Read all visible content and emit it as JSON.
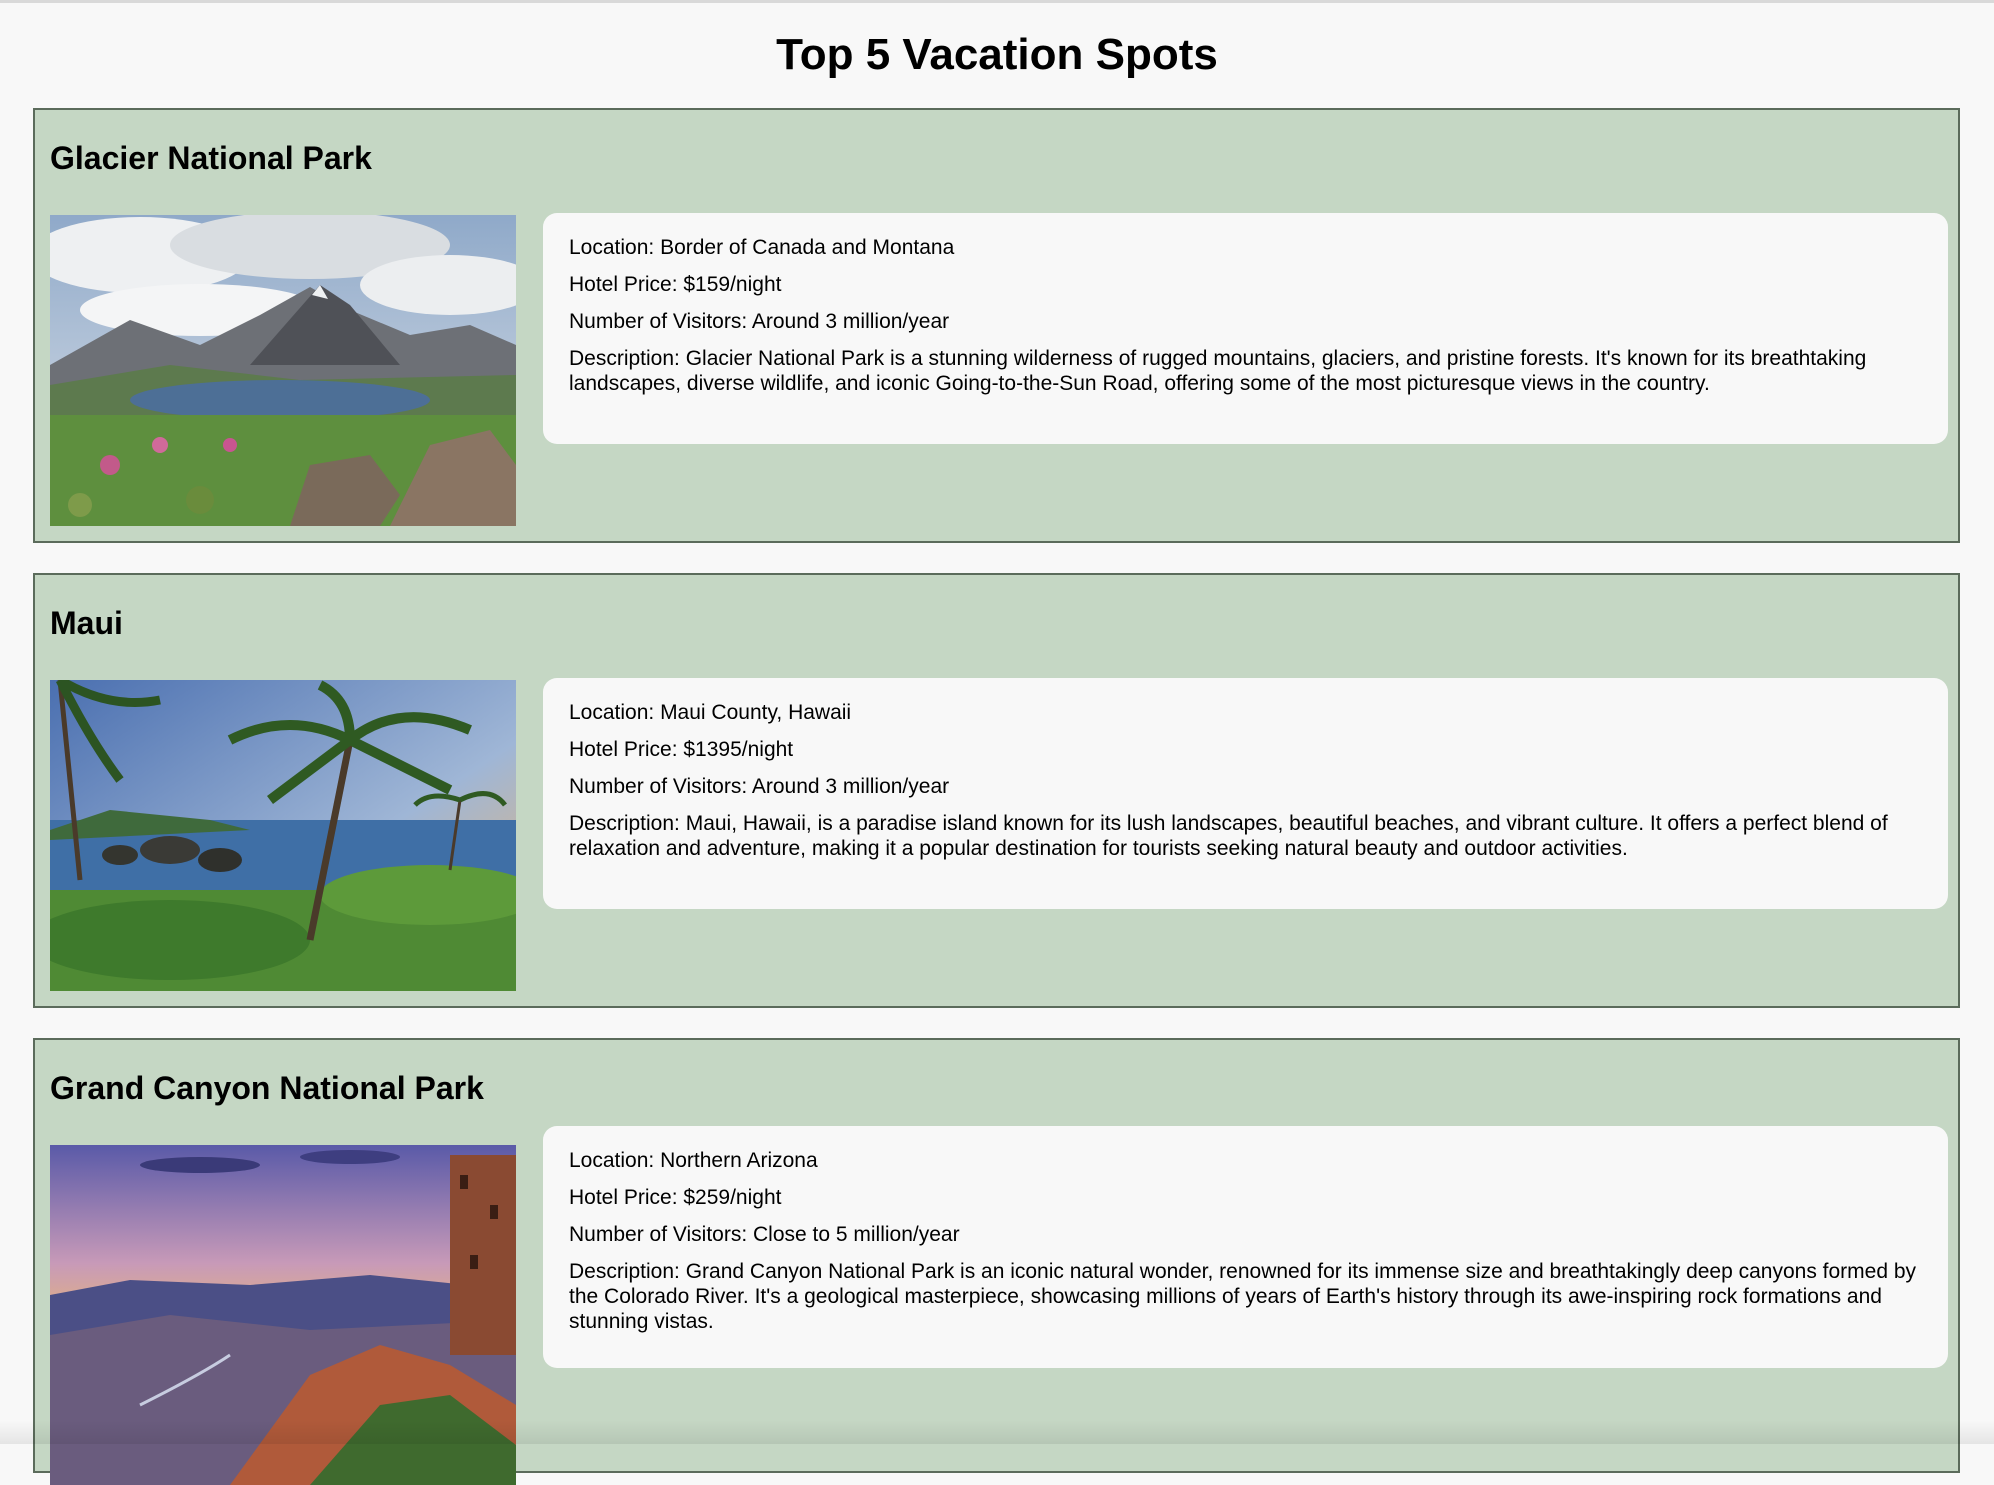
{
  "page": {
    "title": "Top 5 Vacation Spots"
  },
  "spots": [
    {
      "name": "Glacier National Park",
      "image_icon": "mountain-lake-photo",
      "location": "Location: Border of Canada and Montana",
      "hotel_price": "Hotel Price: $159/night",
      "visitors": "Number of Visitors: Around 3 million/year",
      "description": "Description: Glacier National Park is a stunning wilderness of rugged mountains, glaciers, and pristine forests. It's known for its breathtaking landscapes, diverse wildlife, and iconic Going-to-the-Sun Road, offering some of the most picturesque views in the country."
    },
    {
      "name": "Maui",
      "image_icon": "tropical-palm-photo",
      "location": "Location: Maui County, Hawaii",
      "hotel_price": "Hotel Price: $1395/night",
      "visitors": "Number of Visitors: Around 3 million/year",
      "description": "Description: Maui, Hawaii, is a paradise island known for its lush landscapes, beautiful beaches, and vibrant culture. It offers a perfect blend of relaxation and adventure, making it a popular destination for tourists seeking natural beauty and outdoor activities."
    },
    {
      "name": "Grand Canyon National Park",
      "image_icon": "canyon-sunset-photo",
      "location": "Location: Northern Arizona",
      "hotel_price": "Hotel Price: $259/night",
      "visitors": "Number of Visitors: Close to 5 million/year",
      "description": "Description: Grand Canyon National Park is an iconic natural wonder, renowned for its immense size and breathtakingly deep canyons formed by the Colorado River. It's a geological masterpiece, showcasing millions of years of Earth's history through its awe-inspiring rock formations and stunning vistas."
    }
  ],
  "colors": {
    "page_background": "#f8f8f8",
    "card_background": "#c5d7c4",
    "card_border": "#5b6b5b",
    "info_background": "#f8f8f8"
  }
}
